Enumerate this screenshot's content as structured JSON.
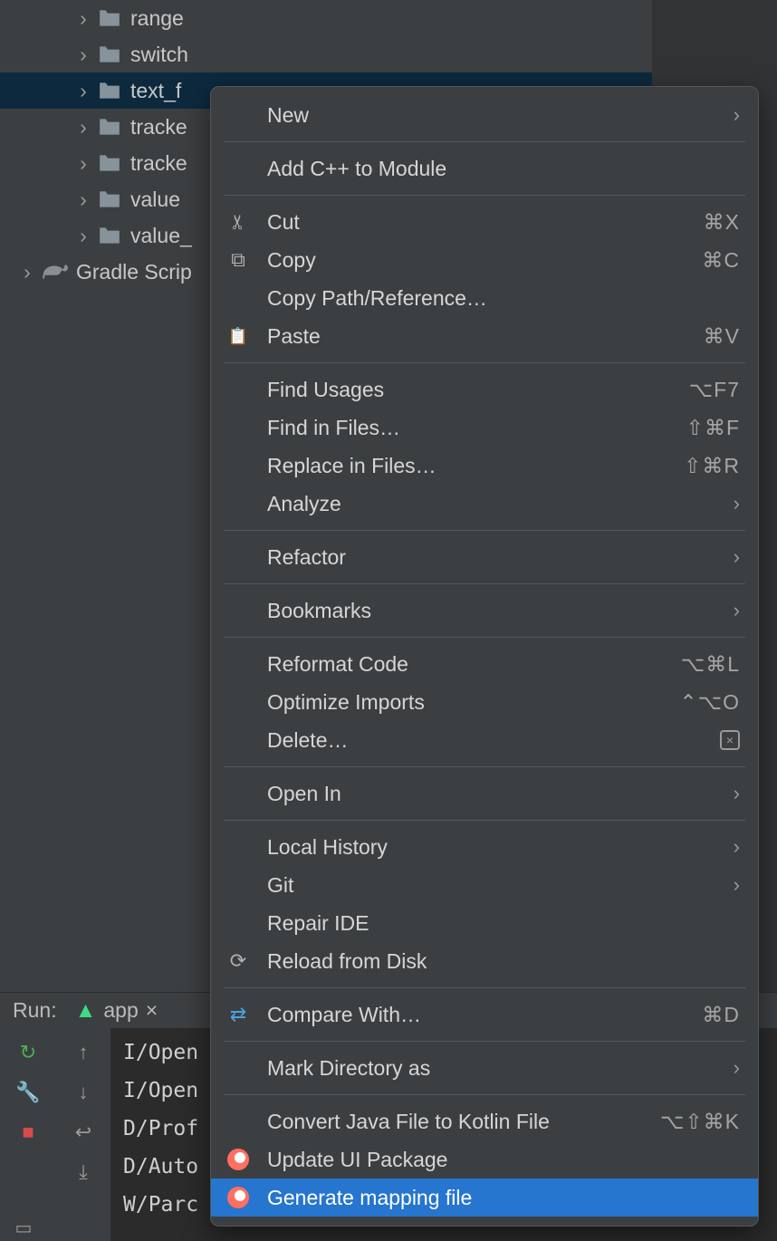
{
  "tree": {
    "items": [
      {
        "label": "range",
        "indent": 1,
        "selected": false
      },
      {
        "label": "switch",
        "indent": 1,
        "selected": false
      },
      {
        "label": "text_f",
        "indent": 1,
        "selected": true
      },
      {
        "label": "tracke",
        "indent": 1,
        "selected": false
      },
      {
        "label": "tracke",
        "indent": 1,
        "selected": false
      },
      {
        "label": "value",
        "indent": 1,
        "selected": false
      },
      {
        "label": "value_",
        "indent": 1,
        "selected": false
      }
    ],
    "gradle_label": "Gradle Scrip"
  },
  "menu": {
    "items": [
      {
        "label": "New",
        "icon": "",
        "shortcut": "",
        "submenu": true
      },
      {
        "sep": true
      },
      {
        "label": "Add C++ to Module",
        "icon": ""
      },
      {
        "sep": true
      },
      {
        "label": "Cut",
        "icon": "scissors",
        "shortcut": "⌘X"
      },
      {
        "label": "Copy",
        "icon": "copy",
        "shortcut": "⌘C"
      },
      {
        "label": "Copy Path/Reference…",
        "icon": ""
      },
      {
        "label": "Paste",
        "icon": "paste",
        "shortcut": "⌘V"
      },
      {
        "sep": true
      },
      {
        "label": "Find Usages",
        "shortcut": "⌥F7"
      },
      {
        "label": "Find in Files…",
        "shortcut": "⇧⌘F"
      },
      {
        "label": "Replace in Files…",
        "shortcut": "⇧⌘R"
      },
      {
        "label": "Analyze",
        "submenu": true
      },
      {
        "sep": true
      },
      {
        "label": "Refactor",
        "submenu": true
      },
      {
        "sep": true
      },
      {
        "label": "Bookmarks",
        "submenu": true
      },
      {
        "sep": true
      },
      {
        "label": "Reformat Code",
        "shortcut": "⌥⌘L"
      },
      {
        "label": "Optimize Imports",
        "shortcut": "⌃⌥O"
      },
      {
        "label": "Delete…",
        "icon": "delete-badge"
      },
      {
        "sep": true
      },
      {
        "label": "Open In",
        "submenu": true
      },
      {
        "sep": true
      },
      {
        "label": "Local History",
        "submenu": true
      },
      {
        "label": "Git",
        "submenu": true
      },
      {
        "label": "Repair IDE"
      },
      {
        "label": "Reload from Disk",
        "icon": "reload"
      },
      {
        "sep": true
      },
      {
        "label": "Compare With…",
        "icon": "compare",
        "shortcut": "⌘D"
      },
      {
        "sep": true
      },
      {
        "label": "Mark Directory as",
        "submenu": true
      },
      {
        "sep": true
      },
      {
        "label": "Convert Java File to Kotlin File",
        "shortcut": "⌥⇧⌘K"
      },
      {
        "label": "Update UI Package",
        "icon": "relay"
      },
      {
        "label": "Generate mapping file",
        "icon": "relay",
        "highlight": true
      }
    ]
  },
  "bottom": {
    "run_label": "Run:",
    "tab_label": "app",
    "tab_close": "×"
  },
  "log": {
    "lines": [
      "I/Open",
      "I/Open",
      "D/Prof",
      "D/Auto",
      "W/Parc"
    ]
  }
}
